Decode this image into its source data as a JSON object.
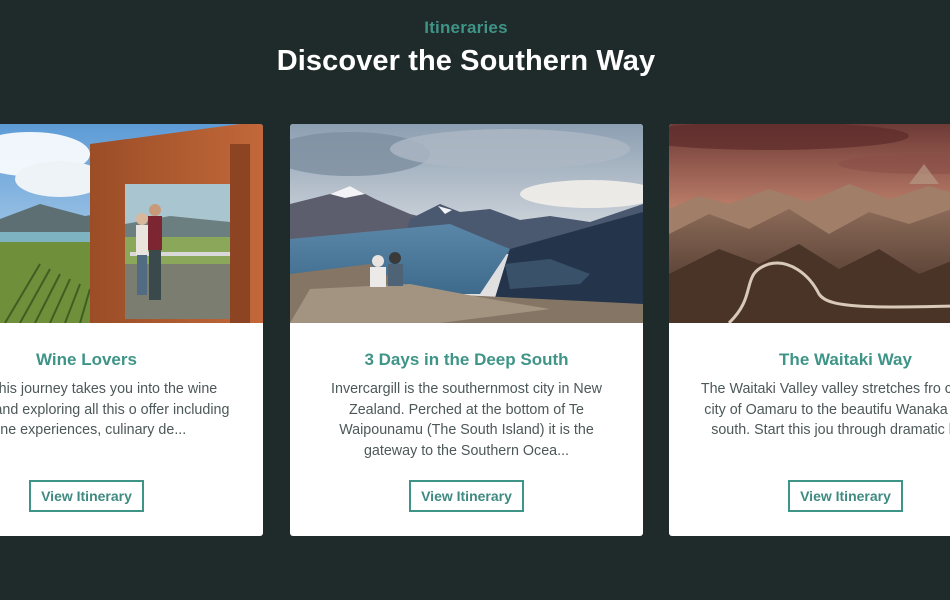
{
  "section": {
    "eyebrow": "Itineraries",
    "heading": "Discover the Southern Way"
  },
  "cards": [
    {
      "title": "Wine Lovers",
      "description": "overs this journey takes you into the wine country and exploring all this o offer including wine experiences, culinary de...",
      "button_label": "View Itinerary",
      "image": "winery-viewing-deck-photo"
    },
    {
      "title": "3 Days in the Deep South",
      "description": "Invercargill is the southernmost city in New Zealand. Perched at the bottom of Te Waipounamu (The South Island) it is the gateway to the Southern Ocea...",
      "button_label": "View Itinerary",
      "image": "lake-and-mountains-photo"
    },
    {
      "title": "The Waitaki Way",
      "description": "The Waitaki Valley valley stretches fro coastal city of Oamaru to the beautifu Wanaka in the south. Start this jou through dramatic lan...",
      "button_label": "View Itinerary",
      "image": "mountain-valley-road-photo"
    }
  ],
  "colors": {
    "background": "#1f2a2a",
    "accent": "#3f9488",
    "heading": "#ffffff",
    "card": "#ffffff"
  }
}
